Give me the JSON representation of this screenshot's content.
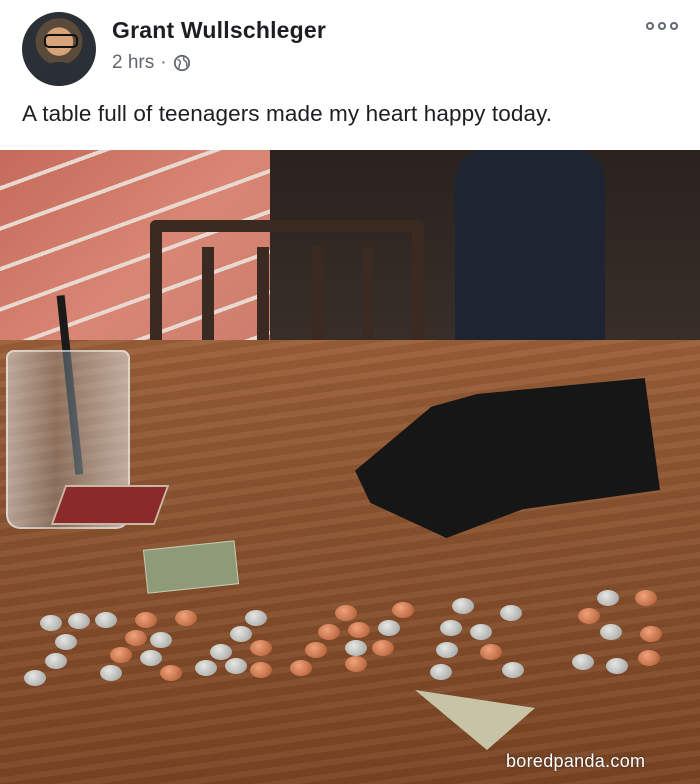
{
  "post": {
    "author": "Grant Wullschleger",
    "time": "2 hrs",
    "separator": "·",
    "privacy_icon": "globe-icon",
    "more_icon": "more-options-icon",
    "caption": "A table full of teenagers made my heart happy today."
  },
  "photo": {
    "watermark": "boredpanda.com"
  }
}
